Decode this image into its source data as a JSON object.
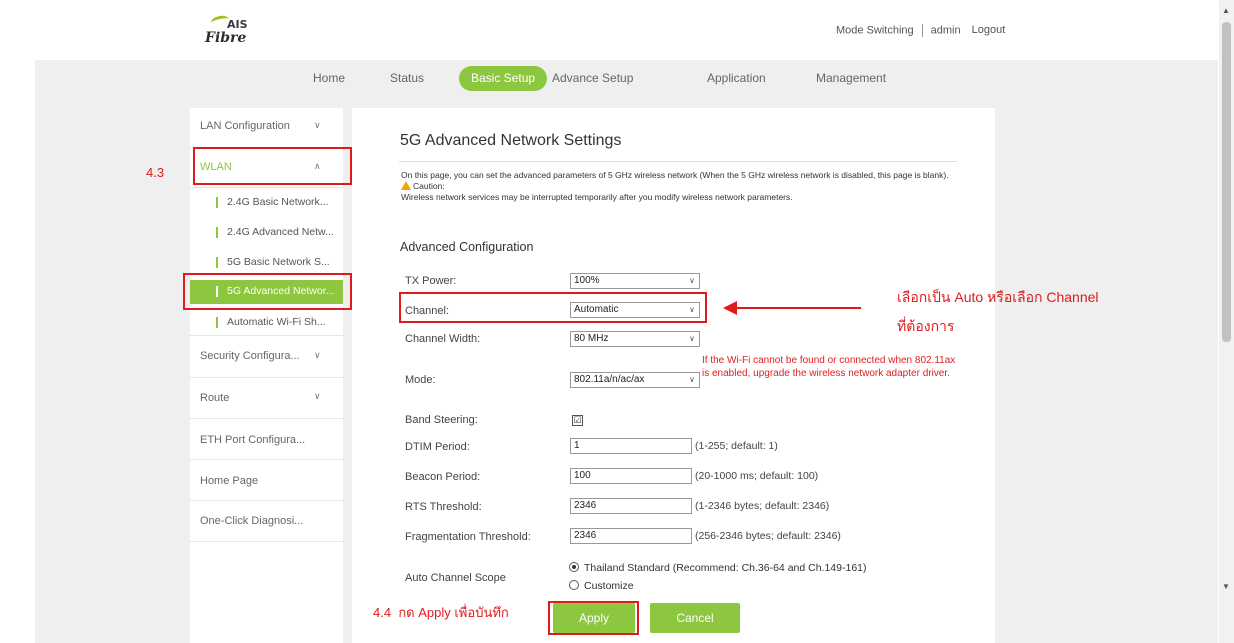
{
  "brand": {
    "logo_top": "AIS",
    "logo_bottom": "Fibre"
  },
  "toplinks": {
    "mode_switching": "Mode Switching",
    "admin": "admin",
    "logout": "Logout"
  },
  "nav": {
    "home": "Home",
    "status": "Status",
    "basic_setup": "Basic Setup",
    "advance_setup": "Advance Setup",
    "application": "Application",
    "management": "Management"
  },
  "sidebar": {
    "lan": "LAN Configuration",
    "wlan": "WLAN",
    "sub": [
      "2.4G Basic Network...",
      "2.4G Advanced Netw...",
      "5G Basic Network S...",
      "5G Advanced Networ...",
      "Automatic Wi-Fi Sh..."
    ],
    "security": "Security Configura...",
    "route": "Route",
    "eth": "ETH Port Configura...",
    "homepage": "Home Page",
    "diagnosis": "One-Click Diagnosi..."
  },
  "main": {
    "title": "5G Advanced Network Settings",
    "desc": "On this page, you can set the advanced parameters of 5 GHz wireless network (When the 5 GHz wireless network is disabled, this page is blank).",
    "caution": "Caution:",
    "caution_text": "Wireless network services may be interrupted temporarily after you modify wireless network parameters.",
    "section": "Advanced Configuration",
    "tx_power_label": "TX Power:",
    "tx_power_value": "100%",
    "channel_label": "Channel:",
    "channel_value": "Automatic",
    "width_label": "Channel Width:",
    "width_value": "80 MHz",
    "mode_label": "Mode:",
    "mode_value": "802.11a/n/ac/ax",
    "mode_note": "If the Wi-Fi cannot be found or connected when 802.11ax is enabled, upgrade the wireless network adapter driver.",
    "band_label": "Band Steering:",
    "band_checked": "☑",
    "dtim_label": "DTIM Period:",
    "dtim_value": "1",
    "dtim_hint": "(1-255; default: 1)",
    "beacon_label": "Beacon Period:",
    "beacon_value": "100",
    "beacon_hint": "(20-1000 ms; default: 100)",
    "rts_label": "RTS Threshold:",
    "rts_value": "2346",
    "rts_hint": "(1-2346 bytes; default: 2346)",
    "frag_label": "Fragmentation Threshold:",
    "frag_value": "2346",
    "frag_hint": "(256-2346 bytes; default: 2346)",
    "scope_label": "Auto Channel Scope",
    "scope_opt1": "Thailand Standard (Recommend: Ch.36-64 and Ch.149-161)",
    "scope_opt2": "Customize",
    "apply": "Apply",
    "cancel": "Cancel"
  },
  "annotations": {
    "step_43": "4.3",
    "step_44": "4.4",
    "apply_note": "กด Apply เพื่อบันทึก",
    "channel_note_1": "เลือกเป็น Auto หรือเลือก Channel",
    "channel_note_2": "ที่ต้องการ"
  },
  "colors": {
    "accent": "#8dc63f",
    "annotation_red": "#e01b1b",
    "panel_bg": "#efefef"
  }
}
